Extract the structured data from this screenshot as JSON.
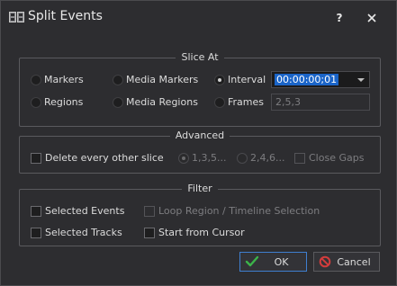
{
  "window": {
    "title": "Split Events",
    "help_label": "?"
  },
  "slice_at": {
    "title": "Slice At",
    "markers": "Markers",
    "media_markers": "Media Markers",
    "interval": "Interval",
    "interval_value": "00:00:00;01",
    "regions": "Regions",
    "media_regions": "Media Regions",
    "frames": "Frames",
    "frames_placeholder": "2,5,3",
    "selected": "interval"
  },
  "advanced": {
    "title": "Advanced",
    "delete_every_other": "Delete every other slice",
    "odd_pattern": "1,3,5...",
    "even_pattern": "2,4,6...",
    "close_gaps": "Close Gaps"
  },
  "filter": {
    "title": "Filter",
    "selected_events": "Selected Events",
    "loop_region": "Loop Region / Timeline Selection",
    "selected_tracks": "Selected Tracks",
    "start_from_cursor": "Start from Cursor"
  },
  "buttons": {
    "ok": "OK",
    "cancel": "Cancel"
  },
  "colors": {
    "background": "#2d2d30",
    "accent": "#1a64c8",
    "ok_icon": "#3cb44a",
    "cancel_icon": "#d23c3c"
  },
  "icons": {
    "app": "filmstrip-icon",
    "close": "close-icon",
    "ok": "check-icon",
    "cancel": "no-entry-icon"
  }
}
